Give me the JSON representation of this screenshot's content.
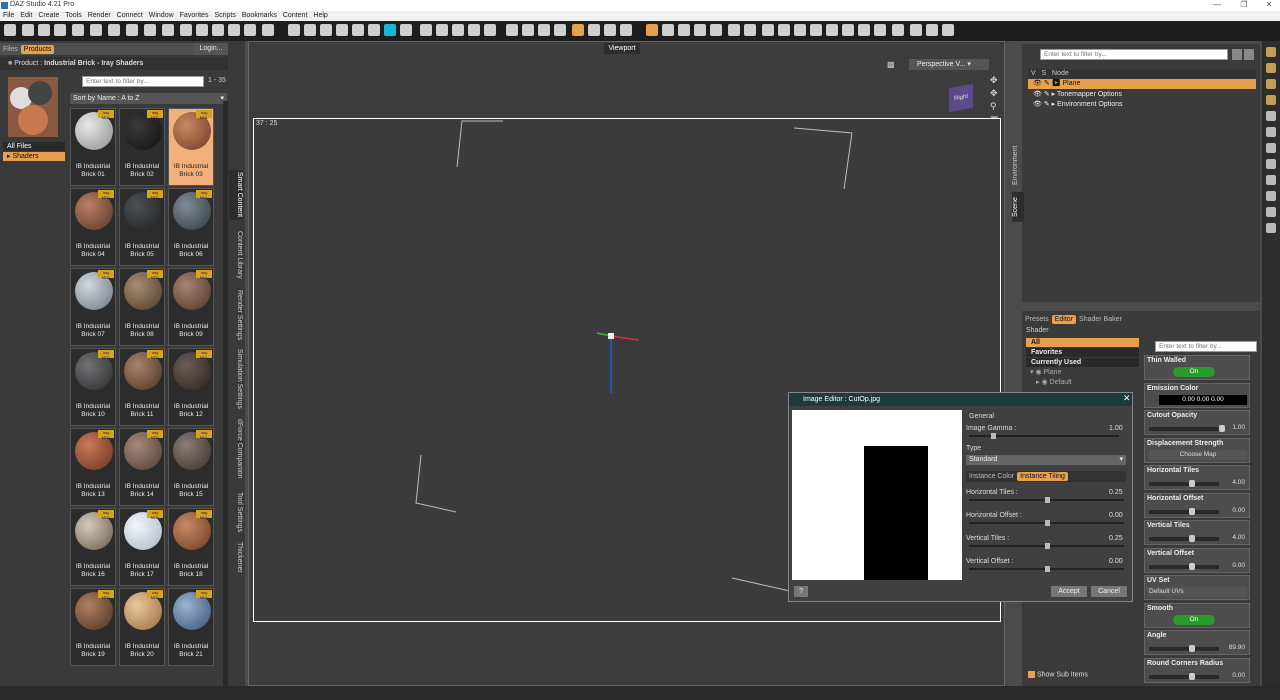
{
  "window": {
    "title": "DAZ Studio 4.21 Pro"
  },
  "menu": [
    "File",
    "Edit",
    "Create",
    "Tools",
    "Render",
    "Connect",
    "Window",
    "Favorites",
    "Scripts",
    "Bookmarks",
    "Content",
    "Help"
  ],
  "left": {
    "tabs": [
      "Files",
      "Products"
    ],
    "login_label": "Login...",
    "breadcrumb_prefix": "Product :",
    "breadcrumb_name": "Industrial Brick - Iray Shaders",
    "filter_placeholder": "Enter text to filter by...",
    "count": "1 - 35",
    "sort_label": "Sort by Name : A to Z",
    "tree": [
      "All Files",
      "Shaders"
    ],
    "items": [
      {
        "label": "IB Industrial Brick 01",
        "c1": "#e8e8e8",
        "c2": "#8d8d8d"
      },
      {
        "label": "IB Industrial Brick 02",
        "c1": "#3a3a3a",
        "c2": "#111111"
      },
      {
        "label": "IB Industrial Brick 03",
        "c1": "#c98a60",
        "c2": "#6d3a22"
      },
      {
        "label": "IB Industrial Brick 04",
        "c1": "#b98064",
        "c2": "#5a3424"
      },
      {
        "label": "IB Industrial Brick 05",
        "c1": "#4e5154",
        "c2": "#1e2022"
      },
      {
        "label": "IB Industrial Brick 06",
        "c1": "#7e8c95",
        "c2": "#303a40"
      },
      {
        "label": "IB Industrial Brick 07",
        "c1": "#d0d6dc",
        "c2": "#6d7780"
      },
      {
        "label": "IB Industrial Brick 08",
        "c1": "#a88c72",
        "c2": "#4a3a2c"
      },
      {
        "label": "IB Industrial Brick 09",
        "c1": "#a58472",
        "c2": "#4c3528"
      },
      {
        "label": "IB Industrial Brick 10",
        "c1": "#717274",
        "c2": "#2a2a2c"
      },
      {
        "label": "IB Industrial Brick 11",
        "c1": "#a8826a",
        "c2": "#4a3424"
      },
      {
        "label": "IB Industrial Brick 12",
        "c1": "#6e5c55",
        "c2": "#2c2220"
      },
      {
        "label": "IB Industrial Brick 13",
        "c1": "#c77a58",
        "c2": "#6a3220"
      },
      {
        "label": "IB Industrial Brick 14",
        "c1": "#a6897a",
        "c2": "#4c3c34"
      },
      {
        "label": "IB Industrial Brick 15",
        "c1": "#8c7c74",
        "c2": "#3a302c"
      },
      {
        "label": "IB Industrial Brick 16",
        "c1": "#d4c8b8",
        "c2": "#6a5c4c"
      },
      {
        "label": "IB Industrial Brick 17",
        "c1": "#f2f6fa",
        "c2": "#a7b6c4"
      },
      {
        "label": "IB Industrial Brick 18",
        "c1": "#c78a64",
        "c2": "#6a3a24"
      },
      {
        "label": "IB Industrial Brick 19",
        "c1": "#b08060",
        "c2": "#4e3020"
      },
      {
        "label": "IB Industrial Brick 20",
        "c1": "#e9c89c",
        "c2": "#9a6a3c"
      },
      {
        "label": "IB Industrial Brick 21",
        "c1": "#9ab2d4",
        "c2": "#3c5070"
      }
    ],
    "badge_text": "Iray MDL",
    "side_tabs": [
      "Smart Content",
      "Content Library",
      "Render Settings",
      "Simulation Settings",
      "dForce Companion",
      "Tool Settings",
      "Thickener"
    ]
  },
  "viewport": {
    "tab": "Viewport",
    "camera": "Perspective V...",
    "coords": "37 : 25",
    "cube_label": "Right"
  },
  "scene": {
    "filter_placeholder": "Enter text to filter by...",
    "cols": [
      "V",
      "S",
      "Node"
    ],
    "nodes": [
      "Plane",
      "Tonemapper Options",
      "Environment Options"
    ],
    "side_tabs": [
      "Environment",
      "Scene"
    ]
  },
  "editor": {
    "tabs": [
      "Presets",
      "Editor",
      "Shader Baker"
    ],
    "section": "Shader",
    "filter_placeholder": "Enter text to filter by...",
    "groups": [
      "All",
      "Favorites",
      "Currently Used"
    ],
    "tree": [
      "Plane",
      "Default"
    ],
    "show_sub": "Show Sub Items",
    "props": [
      {
        "name": "Thin Walled",
        "kind": "toggle",
        "value": "On"
      },
      {
        "name": "Emission Color",
        "kind": "color",
        "value": "0.00    0.00    0.00"
      },
      {
        "name": "Cutout Opacity",
        "kind": "slider",
        "value": "1.00"
      },
      {
        "name": "Displacement Strength",
        "kind": "map",
        "value": "Choose Map"
      },
      {
        "name": "Horizontal Tiles",
        "kind": "slider",
        "value": "4.00"
      },
      {
        "name": "Horizontal Offset",
        "kind": "slider",
        "value": "0.00"
      },
      {
        "name": "Vertical Tiles",
        "kind": "slider",
        "value": "4.00"
      },
      {
        "name": "Vertical Offset",
        "kind": "slider",
        "value": "0.00"
      },
      {
        "name": "UV Set",
        "kind": "select",
        "value": "Default UVs"
      },
      {
        "name": "Smooth",
        "kind": "toggle",
        "value": "On"
      },
      {
        "name": "Angle",
        "kind": "slider",
        "value": "89.90"
      },
      {
        "name": "Round Corners Radius",
        "kind": "slider",
        "value": "0.00"
      }
    ]
  },
  "dialog": {
    "title": "Image Editor : CutOp.jpg",
    "general": "General",
    "gamma_label": "Image Gamma :",
    "gamma_value": "1.00",
    "type_label": "Type",
    "type_value": "Standard",
    "tabs": [
      "Instance Color",
      "Instance Tiling"
    ],
    "tiling": [
      {
        "label": "Horizontal Tiles :",
        "value": "0.25"
      },
      {
        "label": "Horizontal Offset :",
        "value": "0.00"
      },
      {
        "label": "Vertical Tiles :",
        "value": "0.25"
      },
      {
        "label": "Vertical Offset :",
        "value": "0.00"
      }
    ],
    "help": "?",
    "accept": "Accept",
    "cancel": "Cancel"
  }
}
